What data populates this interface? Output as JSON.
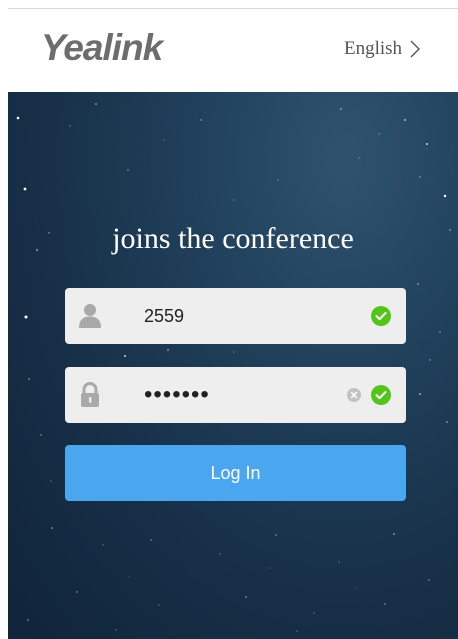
{
  "header": {
    "logo_text": "Yealink",
    "language_label": "English"
  },
  "main": {
    "title": "joins the conference",
    "meeting_field": {
      "value": "2559",
      "valid": true
    },
    "password_field": {
      "masked_value": "•••••••",
      "valid": true
    },
    "login_label": "Log In"
  },
  "colors": {
    "accent": "#4aa6ee",
    "success": "#52c41a",
    "logo": "#6d6d6d",
    "background_dark": "#172f47"
  },
  "icons": {
    "language_chevron": "chevron-right-icon",
    "user": "user-icon",
    "lock": "lock-icon",
    "valid": "check-circle-icon",
    "clear": "clear-icon"
  }
}
